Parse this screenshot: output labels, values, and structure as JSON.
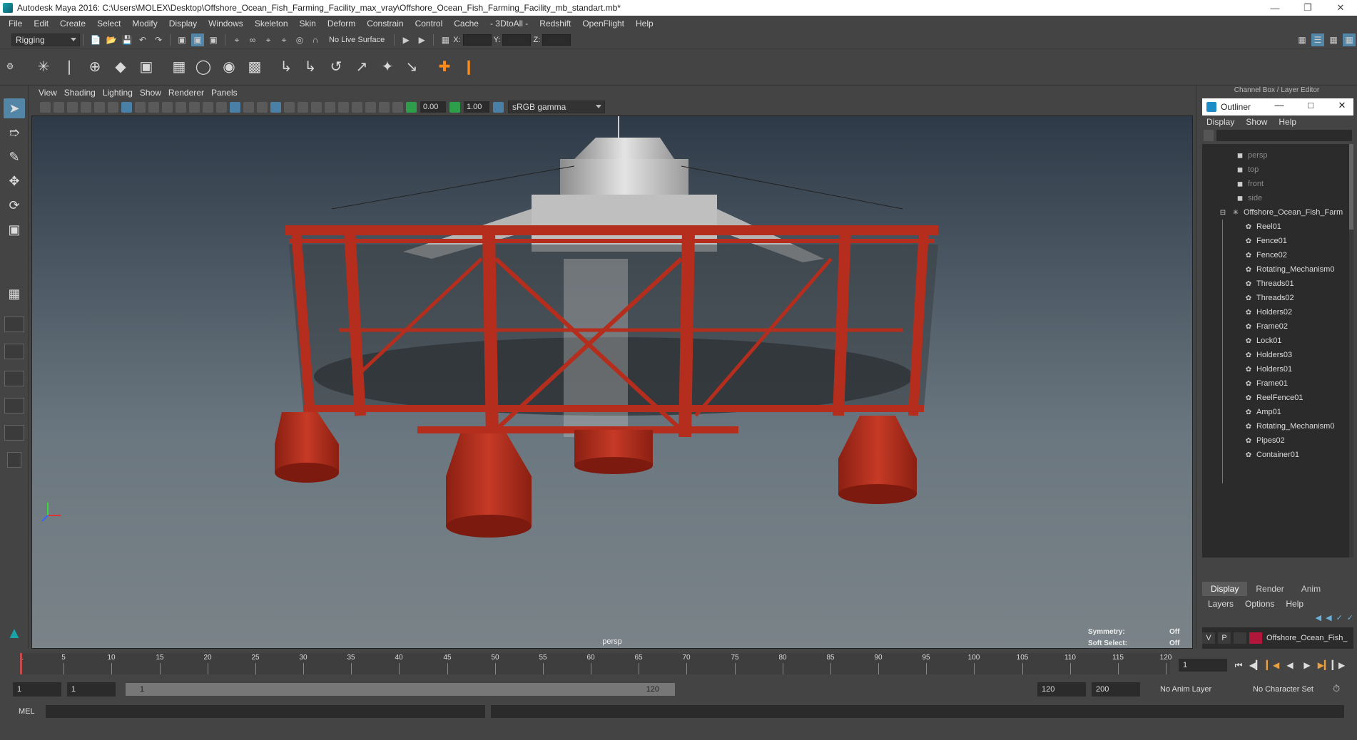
{
  "window": {
    "title": "Autodesk Maya 2016: C:\\Users\\MOLEX\\Desktop\\Offshore_Ocean_Fish_Farming_Facility_max_vray\\Offshore_Ocean_Fish_Farming_Facility_mb_standart.mb*"
  },
  "menubar": [
    "File",
    "Edit",
    "Create",
    "Select",
    "Modify",
    "Display",
    "Windows",
    "Skeleton",
    "Skin",
    "Deform",
    "Constrain",
    "Control",
    "Cache",
    "- 3DtoAll -",
    "Redshift",
    "OpenFlight",
    "Help"
  ],
  "statusline": {
    "mode": "Rigging",
    "live_surface": "No Live Surface",
    "x_label": "X:",
    "y_label": "Y:",
    "z_label": "Z:"
  },
  "viewport": {
    "menus": [
      "View",
      "Shading",
      "Lighting",
      "Show",
      "Renderer",
      "Panels"
    ],
    "exposure": "0.00",
    "gamma": "1.00",
    "color_space": "sRGB gamma",
    "camera_label": "persp",
    "hud": {
      "symmetry_label": "Symmetry:",
      "symmetry_value": "Off",
      "soft_select_label": "Soft Select:",
      "soft_select_value": "Off"
    }
  },
  "right_panel": {
    "header": "Channel Box / Layer Editor",
    "outliner": {
      "title": "Outliner",
      "menus": [
        "Display",
        "Show",
        "Help"
      ],
      "cameras": [
        "persp",
        "top",
        "front",
        "side"
      ],
      "group": "Offshore_Ocean_Fish_Farm",
      "children": [
        "Reel01",
        "Fence01",
        "Fence02",
        "Rotating_Mechanism0",
        "Threads01",
        "Threads02",
        "Holders02",
        "Frame02",
        "Lock01",
        "Holders03",
        "Holders01",
        "Frame01",
        "ReelFence01",
        "Amp01",
        "Rotating_Mechanism0",
        "Pipes02",
        "Container01"
      ]
    },
    "layer_editor": {
      "tabs": [
        "Display",
        "Render",
        "Anim"
      ],
      "active_tab": "Display",
      "menus": [
        "Layers",
        "Options",
        "Help"
      ],
      "layer": {
        "visible": "V",
        "playback": "P",
        "name": "Offshore_Ocean_Fish_",
        "color": "#b0173a"
      }
    }
  },
  "timeline": {
    "labels": [
      "5",
      "10",
      "15",
      "20",
      "25",
      "30",
      "35",
      "40",
      "45",
      "50",
      "55",
      "60",
      "65",
      "70",
      "75",
      "80",
      "85",
      "90",
      "95",
      "100",
      "105",
      "110",
      "115",
      "120"
    ],
    "start_mark": "1",
    "current_frame": "1"
  },
  "range": {
    "start": "1",
    "playback_start": "1",
    "range_start_label": "1",
    "range_end_label": "120",
    "playback_end": "120",
    "end": "200",
    "anim_layer": "No Anim Layer",
    "character_set": "No Character Set"
  },
  "command_line": {
    "language": "MEL"
  }
}
